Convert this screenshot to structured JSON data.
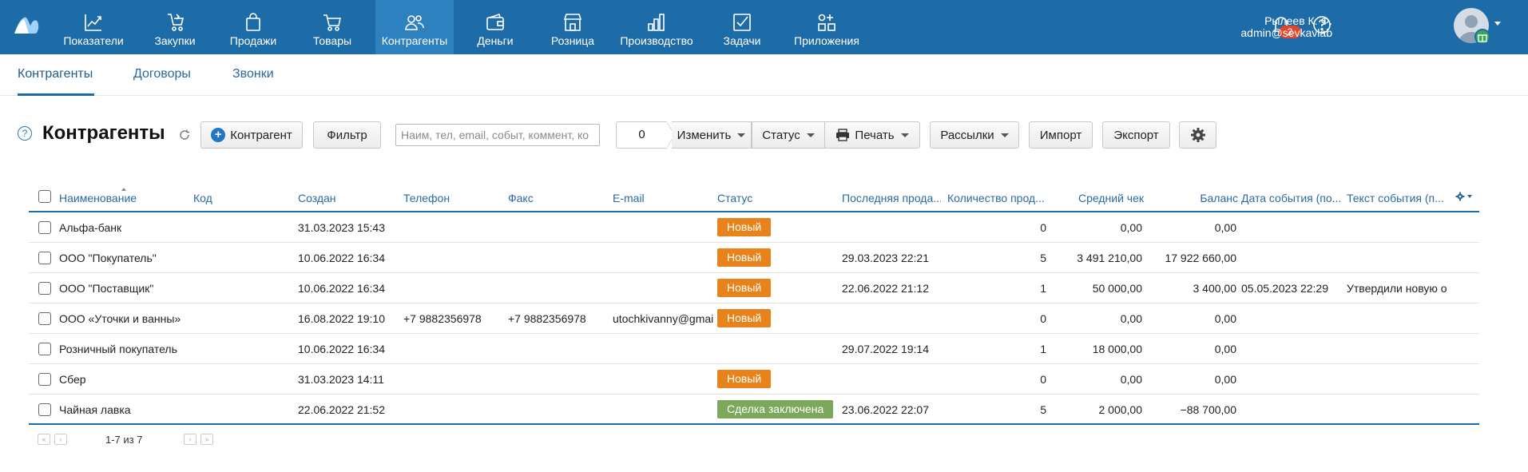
{
  "nav": {
    "items": [
      {
        "label": "Показатели",
        "icon": "chart-line-icon"
      },
      {
        "label": "Закупки",
        "icon": "purchase-icon"
      },
      {
        "label": "Продажи",
        "icon": "shopping-bag-icon"
      },
      {
        "label": "Товары",
        "icon": "cart-icon"
      },
      {
        "label": "Контрагенты",
        "icon": "people-icon"
      },
      {
        "label": "Деньги",
        "icon": "wallet-icon"
      },
      {
        "label": "Розница",
        "icon": "store-icon"
      },
      {
        "label": "Производство",
        "icon": "production-icon"
      },
      {
        "label": "Задачи",
        "icon": "task-check-icon"
      },
      {
        "label": "Приложения",
        "icon": "apps-icon"
      }
    ],
    "active": "Контрагенты"
  },
  "header": {
    "notifications_count": "2",
    "user_name": "Рылеев К. Ф.",
    "user_email": "admin@sevkavlab"
  },
  "subtabs": [
    "Контрагенты",
    "Договоры",
    "Звонки"
  ],
  "toolbar": {
    "page_title": "Контрагенты",
    "help": "?",
    "add_button": "Контрагент",
    "filter_button": "Фильтр",
    "search_placeholder": "Наим, тел, email, событ, коммент, ко",
    "selected_count": "0",
    "change_button": "Изменить",
    "status_button": "Статус",
    "print_button": "Печать",
    "mailing_button": "Рассылки",
    "import_button": "Импорт",
    "export_button": "Экспорт"
  },
  "table": {
    "columns": [
      "Наименование",
      "Код",
      "Создан",
      "Телефон",
      "Факс",
      "E-mail",
      "Статус",
      "Последняя прода...",
      "Количество прод...",
      "Средний чек",
      "Баланс",
      "Дата события (по...",
      "Текст события (п..."
    ],
    "rows": [
      {
        "name": "Альфа-банк",
        "code": "",
        "created": "31.03.2023 15:43",
        "phone": "",
        "fax": "",
        "email": "",
        "status": "Новый",
        "last_sale": "",
        "sales_count": "0",
        "avg_check": "0,00",
        "balance": "0,00",
        "event_date": "",
        "event_text": ""
      },
      {
        "name": "ООО \"Покупатель\"",
        "code": "",
        "created": "10.06.2022 16:34",
        "phone": "",
        "fax": "",
        "email": "",
        "status": "Новый",
        "last_sale": "29.03.2023 22:21",
        "sales_count": "5",
        "avg_check": "3 491 210,00",
        "balance": "17 922 660,00",
        "event_date": "",
        "event_text": ""
      },
      {
        "name": "ООО \"Поставщик\"",
        "code": "",
        "created": "10.06.2022 16:34",
        "phone": "",
        "fax": "",
        "email": "",
        "status": "Новый",
        "last_sale": "22.06.2022 21:12",
        "sales_count": "1",
        "avg_check": "50 000,00",
        "balance": "3 400,00",
        "event_date": "05.05.2023 22:29",
        "event_text": "Утвердили новую о"
      },
      {
        "name": "ООО «Уточки и ванны»",
        "code": "",
        "created": "16.08.2022 19:10",
        "phone": "+7 9882356978",
        "fax": "+7 9882356978",
        "email": "utochkivanny@gmail",
        "status": "Новый",
        "last_sale": "",
        "sales_count": "0",
        "avg_check": "0,00",
        "balance": "0,00",
        "event_date": "",
        "event_text": ""
      },
      {
        "name": "Розничный покупатель",
        "code": "",
        "created": "10.06.2022 16:34",
        "phone": "",
        "fax": "",
        "email": "",
        "status": "",
        "last_sale": "29.07.2022 19:14",
        "sales_count": "1",
        "avg_check": "18 000,00",
        "balance": "0,00",
        "event_date": "",
        "event_text": ""
      },
      {
        "name": "Сбер",
        "code": "",
        "created": "31.03.2023 14:11",
        "phone": "",
        "fax": "",
        "email": "",
        "status": "Новый",
        "last_sale": "",
        "sales_count": "0",
        "avg_check": "0,00",
        "balance": "0,00",
        "event_date": "",
        "event_text": ""
      },
      {
        "name": "Чайная лавка",
        "code": "",
        "created": "22.06.2022 21:52",
        "phone": "",
        "fax": "",
        "email": "",
        "status": "Сделка заключена",
        "last_sale": "23.06.2022 22:07",
        "sales_count": "5",
        "avg_check": "2 000,00",
        "balance": "−88 700,00",
        "event_date": "",
        "event_text": ""
      }
    ]
  },
  "status_colors": {
    "Новый": "#e8831b",
    "Сделка заключена": "#7ba85a"
  },
  "colors": {
    "nav_bg": "#1d6ca8",
    "nav_active": "#2d81be",
    "accent": "#2a6aa1"
  },
  "pager": {
    "text": "1-7 из 7"
  }
}
